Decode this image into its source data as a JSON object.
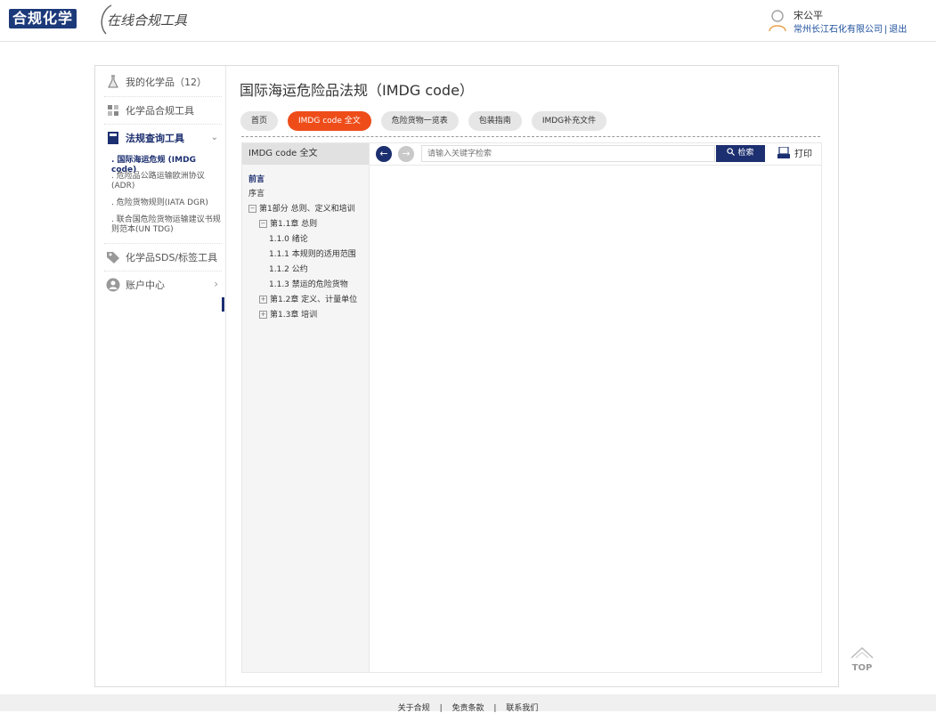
{
  "header": {
    "logo_text": "合规化学",
    "logo_sub": "在线合规工具",
    "user_name": "宋公平",
    "user_company": "常州长江石化有限公司",
    "separator": "|",
    "logout": "退出"
  },
  "sidebar": {
    "items": [
      {
        "label": "我的化学品（12）",
        "icon": "flask-icon"
      },
      {
        "label": "化学品合规工具",
        "icon": "tools-icon"
      },
      {
        "label": "法规查询工具",
        "icon": "book-icon"
      },
      {
        "label": "化学品SDS/标签工具",
        "icon": "tag-icon"
      },
      {
        "label": "账户中心",
        "icon": "user-icon"
      }
    ],
    "sub_items": [
      ". 国际海运危规 (IMDG code)",
      ". 危险品公路运输欧洲协议 (ADR)",
      ". 危险货物规则(IATA DGR)",
      ". 联合国危险货物运输建议书规则范本(UN TDG)"
    ]
  },
  "main": {
    "title": "国际海运危险品法规（IMDG code）",
    "tabs": [
      "首页",
      "IMDG code 全文",
      "危险货物一览表",
      "包装指南",
      "IMDG补充文件"
    ],
    "active_tab": 1
  },
  "tree": {
    "header": "IMDG code 全文",
    "nodes": [
      {
        "label": "前言",
        "bold": true,
        "box": ""
      },
      {
        "label": "序言",
        "bold": false,
        "box": ""
      },
      {
        "label": "第1部分 总则、定义和培训",
        "bold": false,
        "box": "−"
      },
      {
        "label": "第1.1章 总则",
        "bold": false,
        "box": "−"
      },
      {
        "label": "1.1.0 绪论",
        "bold": false,
        "box": ""
      },
      {
        "label": "1.1.1 本规则的适用范围",
        "bold": false,
        "box": ""
      },
      {
        "label": "1.1.2 公约",
        "bold": false,
        "box": ""
      },
      {
        "label": "1.1.3 禁运的危险货物",
        "bold": false,
        "box": ""
      },
      {
        "label": "第1.2章 定义、计量单位",
        "bold": false,
        "box": "+"
      },
      {
        "label": "第1.3章 培训",
        "bold": false,
        "box": "+"
      }
    ]
  },
  "toolbar": {
    "search_placeholder": "请输入关键字检索",
    "search_label": "检索",
    "print_label": "打印",
    "back_icon": "←",
    "forward_icon": "→"
  },
  "footer": {
    "links": [
      "关于合规",
      "|",
      "免责条款",
      "|",
      "联系我们"
    ]
  },
  "top_button": "TOP",
  "colors": {
    "brand": "#1c2f70",
    "active_tab": "#ee4d1a"
  }
}
